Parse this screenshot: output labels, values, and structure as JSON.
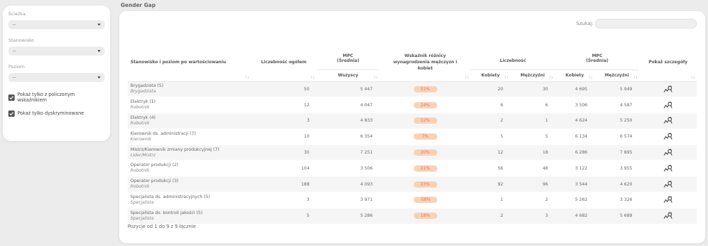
{
  "filters": {
    "sciezka_label": "Ścieżka",
    "sciezka_value": "--",
    "stanowisko_label": "Stanowisko",
    "stanowisko_value": "--",
    "poziom_label": "Poziom",
    "poziom_value": "--",
    "checkbox1_label": "Pokaż tylko z policzonym wskaźnikiem",
    "checkbox2_label": "Pokaż tylko dyskryminowane"
  },
  "section_title": "Gender Gap",
  "search": {
    "label": "Szukaj:",
    "value": ""
  },
  "table": {
    "headers": {
      "position": "Stanowisko i poziom po wartościowaniu",
      "count_total": "Liczebność ogółem",
      "mpc_line1": "MPC",
      "mpc_line2": "(Średnia)",
      "mpc_all": "Wszyscy",
      "gap": "Wskaźnik różnicy wynagrodzenia mężczyzn i kobiet",
      "count_group": "Liczebność",
      "women": "Kobiety",
      "men": "Mężczyźni",
      "details": "Pokaż szczegóły"
    },
    "rows": [
      {
        "name": "Brygadzista (5)",
        "role": "Brygadzista",
        "total": "50",
        "mpc": "5 447",
        "gap": "21%",
        "women": "20",
        "men": "30",
        "mpc_w": "4 695",
        "mpc_m": "5 949"
      },
      {
        "name": "Elektryk (1)",
        "role": "Robotnik",
        "total": "12",
        "mpc": "4 047",
        "gap": "24%",
        "women": "6",
        "men": "6",
        "mpc_w": "3 506",
        "mpc_m": "4 587"
      },
      {
        "name": "Elektryk (4)",
        "role": "Robotnik",
        "total": "3",
        "mpc": "4 833",
        "gap": "12%",
        "women": "2",
        "men": "1",
        "mpc_w": "4 624",
        "mpc_m": "5 250"
      },
      {
        "name": "Kierownik ds. administracji (7)",
        "role": "Kierownik",
        "total": "10",
        "mpc": "6 354",
        "gap": "7%",
        "women": "5",
        "men": "5",
        "mpc_w": "6 134",
        "mpc_m": "6 574"
      },
      {
        "name": "Mistrz/Kierownik zmiany produkcyjnej (7)",
        "role": "Lider/Mistrz",
        "total": "30",
        "mpc": "7 251",
        "gap": "20%",
        "women": "12",
        "men": "18",
        "mpc_w": "6 286",
        "mpc_m": "7 895"
      },
      {
        "name": "Operator produkcji (2)",
        "role": "Robotnik",
        "total": "104",
        "mpc": "3 506",
        "gap": "21%",
        "women": "56",
        "men": "48",
        "mpc_w": "3 122",
        "mpc_m": "3 955"
      },
      {
        "name": "Operator produkcji (3)",
        "role": "Robotnik",
        "total": "188",
        "mpc": "4 093",
        "gap": "23%",
        "women": "92",
        "men": "96",
        "mpc_w": "3 544",
        "mpc_m": "4 620"
      },
      {
        "name": "Specjalista ds. administracyjnych (5)",
        "role": "Specjalista",
        "total": "3",
        "mpc": "3 971",
        "gap": "-58%",
        "women": "1",
        "men": "2",
        "mpc_w": "5 262",
        "mpc_m": "3 326"
      },
      {
        "name": "Specjalista ds. kontroli jakości (5)",
        "role": "Specjalista",
        "total": "5",
        "mpc": "5 286",
        "gap": "18%",
        "women": "2",
        "men": "3",
        "mpc_w": "4 682",
        "mpc_m": "5 689"
      }
    ]
  },
  "footer": "Pozycje od 1 do 9 z 9 łącznie",
  "colors": {
    "gap_pill_bg": "#f8d2b8",
    "gap_pill_text": "#e07a4f"
  },
  "icons": {
    "details": "gender-chart-icon",
    "sort": "sort-arrows-icon",
    "dropdown": "chevron-down-icon",
    "checkbox": "checkmark-icon"
  }
}
